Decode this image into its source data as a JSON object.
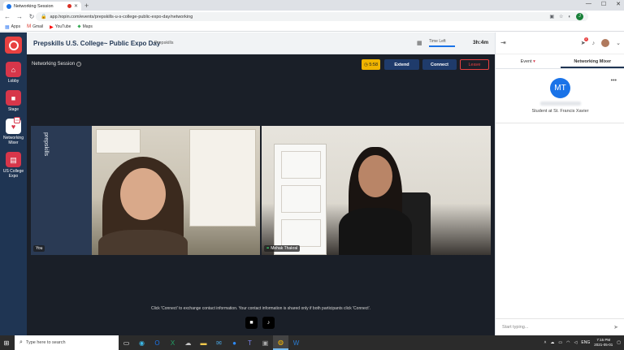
{
  "browser": {
    "tab_title": "Networking Session",
    "url": "app.hopin.com/events/prepskills-u-s-college-public-expo-day/networking",
    "profile_initial": "J",
    "bookmarks": [
      {
        "icon": "apps-grid-icon",
        "label": "Apps"
      },
      {
        "icon": "gmail-icon",
        "label": "Gmail"
      },
      {
        "icon": "youtube-icon",
        "label": "YouTube"
      },
      {
        "icon": "maps-icon",
        "label": "Maps"
      }
    ]
  },
  "sidebar": {
    "items": [
      {
        "label": "Lobby",
        "icon": "home-icon"
      },
      {
        "label": "Stage",
        "icon": "video-camera-icon"
      },
      {
        "label": "Networking Mixer",
        "icon": "mixer-icon",
        "active": true
      },
      {
        "label": "US College Expo",
        "icon": "expo-booth-icon"
      }
    ]
  },
  "header": {
    "event_title": "Prepskills U.S. College~ Public Expo Day",
    "organizer": "Prepskills",
    "time_left_label": "Time Left",
    "time_left_value": "3h:4m"
  },
  "stage": {
    "session_title": "Networking Session",
    "timer_label": "5:58",
    "extend_label": "Extend",
    "connect_label": "Connect",
    "leave_label": "Leave",
    "banner_text": "prepskills",
    "participants": [
      {
        "name": "You"
      },
      {
        "name": "Mehak Thakral"
      }
    ],
    "hint": "Click 'Connect' to exchange contact information. Your contact information is shared only if both participants click 'Connect'."
  },
  "right_panel": {
    "tabs": [
      {
        "label": "Event",
        "active": false
      },
      {
        "label": "Networking Mixer",
        "active": true
      }
    ],
    "notification_count": "1",
    "match": {
      "initials": "MT",
      "role": "Student at St. Francis Xavier"
    },
    "chat_placeholder": "Start typing..."
  },
  "taskbar": {
    "search_placeholder": "Type here to search",
    "lang": "ENG",
    "time": "7:15 PM",
    "date": "2021-05-01"
  },
  "colors": {
    "sidebar_bg": "#1f3553",
    "accent_red": "#d7364a",
    "stage_bg": "#1a1f28",
    "button_blue": "#1f3b6b",
    "timer_yellow": "#f0b400",
    "avatar_blue": "#1a73e8"
  }
}
